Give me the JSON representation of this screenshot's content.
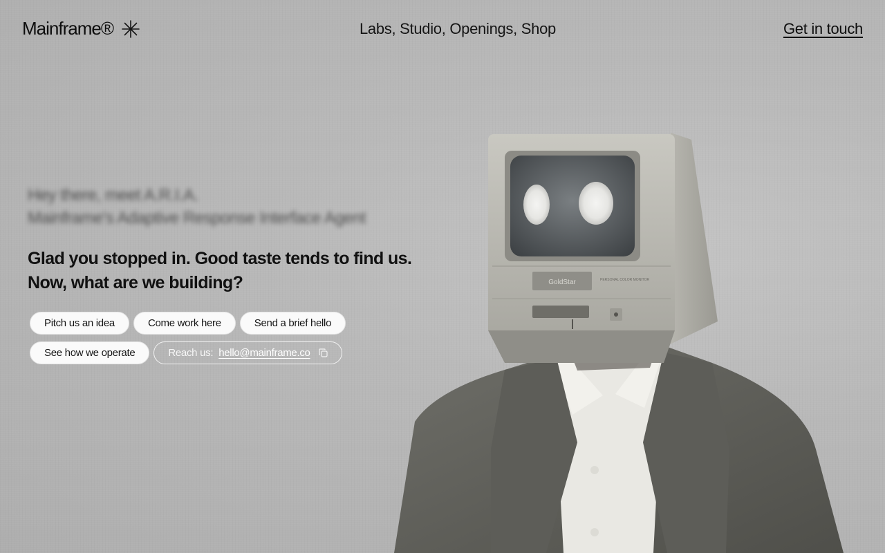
{
  "brand": {
    "name": "Mainframe®",
    "icon": "asterisk-icon"
  },
  "nav": {
    "items": [
      "Labs",
      "Studio",
      "Openings",
      "Shop"
    ],
    "labs": "Labs,",
    "studio": "Studio,",
    "openings": "Openings,",
    "shop": "Shop"
  },
  "cta": {
    "label": "Get in touch"
  },
  "intro": {
    "line1": "Hey there, meet A.R.I.A.",
    "line2": "Mainframe's Adaptive Response Interface Agent"
  },
  "headline": {
    "line1": "Glad you stopped in. Good taste tends to find us.",
    "line2": "Now, what are we building?"
  },
  "chips": {
    "pitch": "Pitch us an idea",
    "work": "Come work here",
    "hello": "Send a brief hello",
    "operate": "See how we operate",
    "reach_label": "Reach us:",
    "email": "hello@mainframe.co"
  },
  "hero": {
    "screen_brand": "GoldStar",
    "screen_sub": "PERSONAL COLOR MONITOR"
  },
  "colors": {
    "background": "#bcbcbc",
    "text": "#111111",
    "chip_bg": "#fafafa"
  }
}
